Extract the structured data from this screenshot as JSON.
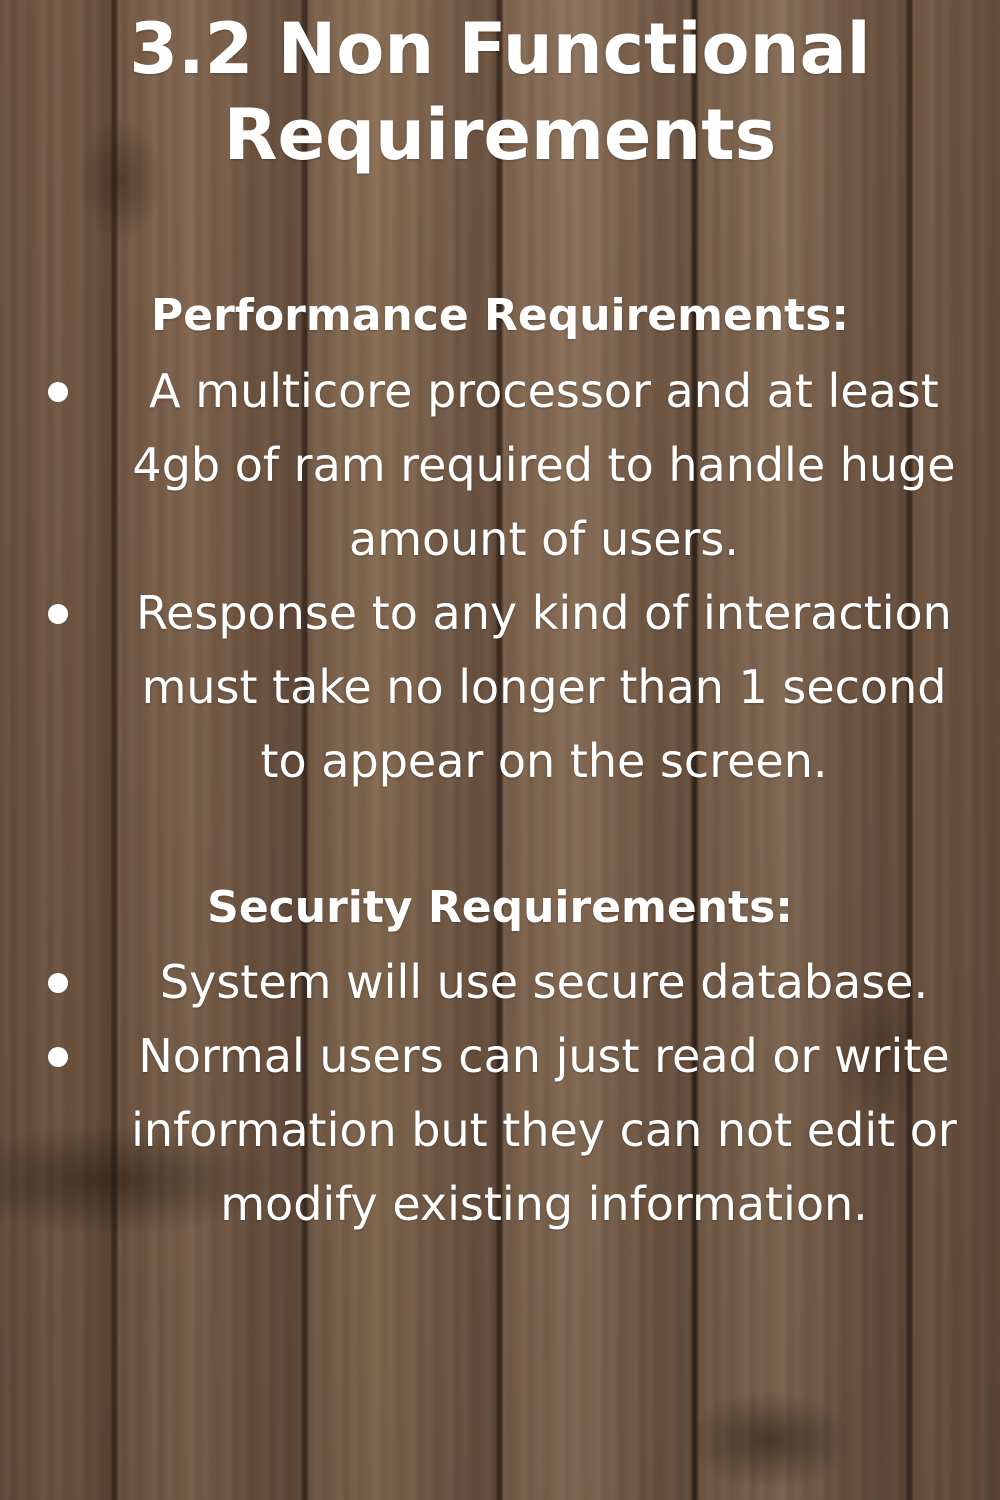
{
  "title": {
    "line1": "3.2 Non Functional",
    "line2": "Requirements"
  },
  "sections": [
    {
      "heading": "Performance Requirements:",
      "items": [
        {
          "lines": [
            "A multicore processor and at least",
            "4gb of ram required to handle huge",
            "amount of users."
          ]
        },
        {
          "lines": [
            "Response to any kind of interaction",
            "must take no longer than 1 second",
            "to appear on the screen."
          ]
        }
      ]
    },
    {
      "heading": "Security Requirements:",
      "items": [
        {
          "lines": [
            "System will use secure database."
          ]
        },
        {
          "lines": [
            "Normal users can just read or write",
            "information but they can not edit or",
            "modify existing information."
          ]
        }
      ]
    }
  ],
  "colors": {
    "text": "#ffffff",
    "background": "wood-texture"
  }
}
